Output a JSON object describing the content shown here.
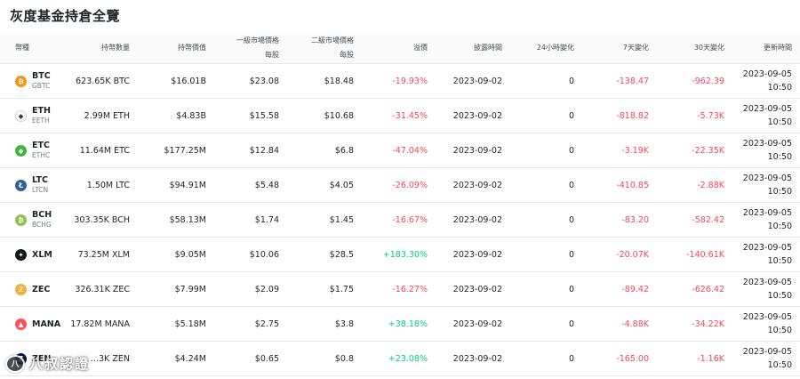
{
  "title": "灰度基金持倉全覽",
  "headers": {
    "name": "幣種",
    "holding": "持幣數量",
    "value": "持幣價值",
    "primary_line1": "一級市場價格",
    "primary_line2": "每股",
    "secondary_line1": "二級市場價格",
    "secondary_line2": "每股",
    "premium": "溢價",
    "date": "披露時間",
    "d24": "24小時變化",
    "d7": "7天變化",
    "d30": "30天變化",
    "updated": "更新時間"
  },
  "rows": [
    {
      "symbol": "BTC",
      "trust": "GBTC",
      "icon": "btc-icon",
      "icon_color": "#f7931a",
      "icon_glyph": "₿",
      "holding": "623.65K BTC",
      "value": "$16.01B",
      "primary": "$23.08",
      "secondary": "$18.48",
      "premium": "-19.93%",
      "premium_sign": "neg",
      "date": "2023-09-02",
      "d24": "0",
      "d7": "-138.47",
      "d7_sign": "neg",
      "d30": "-962.39",
      "d30_sign": "neg",
      "updated_date": "2023-09-05",
      "updated_time": "10:50"
    },
    {
      "symbol": "ETH",
      "trust": "EETH",
      "icon": "eth-icon",
      "icon_color": "#ffffff",
      "icon_glyph": "◆",
      "holding": "2.99M ETH",
      "value": "$4.83B",
      "primary": "$15.58",
      "secondary": "$10.68",
      "premium": "-31.45%",
      "premium_sign": "neg",
      "date": "2023-09-02",
      "d24": "0",
      "d7": "-818.82",
      "d7_sign": "neg",
      "d30": "-5.73K",
      "d30_sign": "neg",
      "updated_date": "2023-09-05",
      "updated_time": "10:50"
    },
    {
      "symbol": "ETC",
      "trust": "ETHC",
      "icon": "etc-icon",
      "icon_color": "#3ab83a",
      "icon_glyph": "◆",
      "holding": "11.64M ETC",
      "value": "$177.25M",
      "primary": "$12.84",
      "secondary": "$6.8",
      "premium": "-47.04%",
      "premium_sign": "neg",
      "date": "2023-09-02",
      "d24": "0",
      "d7": "-3.19K",
      "d7_sign": "neg",
      "d30": "-22.35K",
      "d30_sign": "neg",
      "updated_date": "2023-09-05",
      "updated_time": "10:50"
    },
    {
      "symbol": "LTC",
      "trust": "LTCN",
      "icon": "ltc-icon",
      "icon_color": "#345d9d",
      "icon_glyph": "Ł",
      "holding": "1.50M LTC",
      "value": "$94.91M",
      "primary": "$5.48",
      "secondary": "$4.05",
      "premium": "-26.09%",
      "premium_sign": "neg",
      "date": "2023-09-02",
      "d24": "0",
      "d7": "-410.85",
      "d7_sign": "neg",
      "d30": "-2.88K",
      "d30_sign": "neg",
      "updated_date": "2023-09-05",
      "updated_time": "10:50"
    },
    {
      "symbol": "BCH",
      "trust": "BCHG",
      "icon": "bch-icon",
      "icon_color": "#8dc351",
      "icon_glyph": "₿",
      "holding": "303.35K BCH",
      "value": "$58.13M",
      "primary": "$1.74",
      "secondary": "$1.45",
      "premium": "-16.67%",
      "premium_sign": "neg",
      "date": "2023-09-02",
      "d24": "0",
      "d7": "-83.20",
      "d7_sign": "neg",
      "d30": "-582.42",
      "d30_sign": "neg",
      "updated_date": "2023-09-05",
      "updated_time": "10:50"
    },
    {
      "symbol": "XLM",
      "trust": "",
      "icon": "xlm-icon",
      "icon_color": "#14171a",
      "icon_glyph": "✦",
      "holding": "73.25M XLM",
      "value": "$9.05M",
      "primary": "$10.06",
      "secondary": "$28.5",
      "premium": "+183.30%",
      "premium_sign": "pos",
      "date": "2023-09-02",
      "d24": "0",
      "d7": "-20.07K",
      "d7_sign": "neg",
      "d30": "-140.61K",
      "d30_sign": "neg",
      "updated_date": "2023-09-05",
      "updated_time": "10:50"
    },
    {
      "symbol": "ZEC",
      "trust": "",
      "icon": "zec-icon",
      "icon_color": "#ecb244",
      "icon_glyph": "ℤ",
      "holding": "326.31K ZEC",
      "value": "$7.99M",
      "primary": "$2.09",
      "secondary": "$1.75",
      "premium": "-16.27%",
      "premium_sign": "neg",
      "date": "2023-09-02",
      "d24": "0",
      "d7": "-89.42",
      "d7_sign": "neg",
      "d30": "-626.42",
      "d30_sign": "neg",
      "updated_date": "2023-09-05",
      "updated_time": "10:50"
    },
    {
      "symbol": "MANA",
      "trust": "",
      "icon": "mana-icon",
      "icon_color": "#ff4f5a",
      "icon_glyph": "▲",
      "holding": "17.82M MANA",
      "value": "$5.18M",
      "primary": "$2.75",
      "secondary": "$3.8",
      "premium": "+38.18%",
      "premium_sign": "pos",
      "date": "2023-09-02",
      "d24": "0",
      "d7": "-4.88K",
      "d7_sign": "neg",
      "d30": "-34.22K",
      "d30_sign": "neg",
      "updated_date": "2023-09-05",
      "updated_time": "10:50"
    },
    {
      "symbol": "ZEN",
      "trust": "",
      "icon": "zen-icon",
      "icon_color": "#041742",
      "icon_glyph": "Z",
      "holding": "…3K ZEN",
      "value": "$4.24M",
      "primary": "$0.65",
      "secondary": "$0.8",
      "premium": "+23.08%",
      "premium_sign": "pos",
      "date": "2023-09-02",
      "d24": "0",
      "d7": "-165.00",
      "d7_sign": "neg",
      "d30": "-1.16K",
      "d30_sign": "neg",
      "updated_date": "2023-09-05",
      "updated_time": "10:50"
    }
  ],
  "watermark": {
    "text": "八叔認證",
    "logo_glyph": "八"
  }
}
